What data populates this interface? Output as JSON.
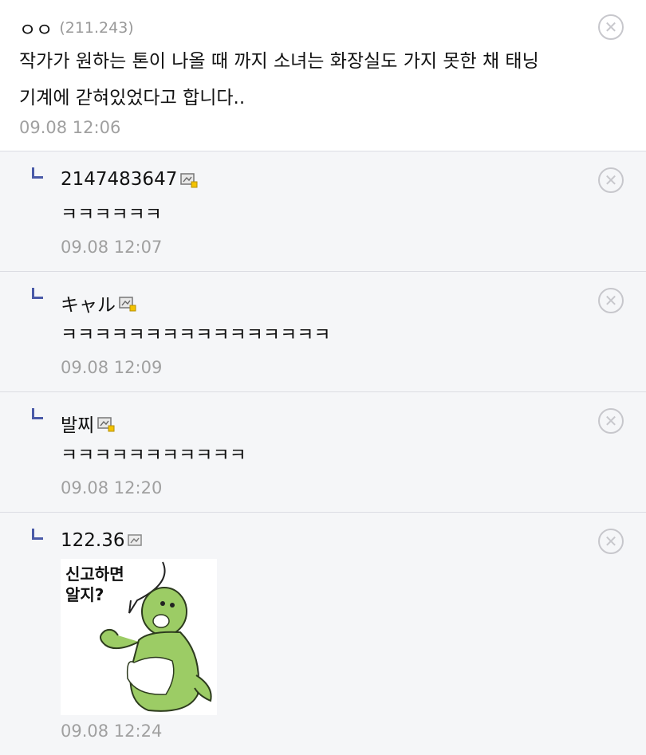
{
  "comments": [
    {
      "nick": "ㅇㅇ",
      "ip": "(211.243)",
      "text_lines": [
        "작가가 원하는 톤이 나올 때 까지 소녀는 화장실도 가지 못한 채 태닝",
        "기계에 갇혀있었다고 합니다.."
      ],
      "date": "09.08 12:06"
    }
  ],
  "replies": [
    {
      "nick": "2147483647",
      "text": "ㅋㅋㅋㅋㅋㅋ",
      "date": "09.08 12:07"
    },
    {
      "nick": "キャル",
      "text": "ㅋㅋㅋㅋㅋㅋㅋㅋㅋㅋㅋㅋㅋㅋㅋㅋ",
      "date": "09.08 12:09"
    },
    {
      "nick": "발찌",
      "text": "ㅋㅋㅋㅋㅋㅋㅋㅋㅋㅋㅋ",
      "date": "09.08 12:20"
    },
    {
      "nick": "122.36",
      "sticker_text": [
        "신고하면",
        "알지?"
      ],
      "date": "09.08 12:24"
    }
  ],
  "icons": {
    "close": "close-circle-icon",
    "reply": "reply-arrow-icon",
    "member": "member-badge-icon"
  },
  "colors": {
    "reply_bg": "#f5f6f8",
    "reply_arrow": "#4a5aa8",
    "date": "#a0a0a0",
    "sticker_character": "#9ccc65"
  }
}
